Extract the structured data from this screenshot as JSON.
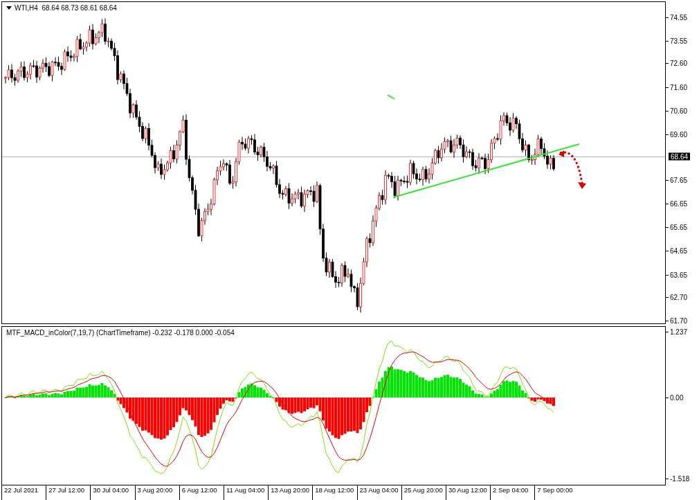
{
  "main_chart": {
    "header": "WTI,H4  68.64 68.73 68.61 68.64",
    "price_ticks": [
      "74.55",
      "73.55",
      "72.60",
      "71.60",
      "70.60",
      "69.60",
      "67.65",
      "66.65",
      "65.65",
      "64.65",
      "63.65",
      "62.70",
      "61.70"
    ],
    "current_price": "68.64"
  },
  "indicator": {
    "header": "MTF_MACD_inColor(7,19,7) (ChartTimeframe) -0.232 -0.178 0.000 -0.054",
    "ticks": [
      "1.237",
      "0.00",
      "-1.518"
    ]
  },
  "time_axis": [
    "22 Jul 2021",
    "27 Jul 12:00",
    "30 Jul 04:00",
    "3 Aug 20:00",
    "6 Aug 12:00",
    "11 Aug 04:00",
    "13 Aug 20:00",
    "18 Aug 12:00",
    "23 Aug 04:00",
    "25 Aug 20:00",
    "30 Aug 12:00",
    "2 Sep 04:00",
    "7 Sep 00:00"
  ]
}
